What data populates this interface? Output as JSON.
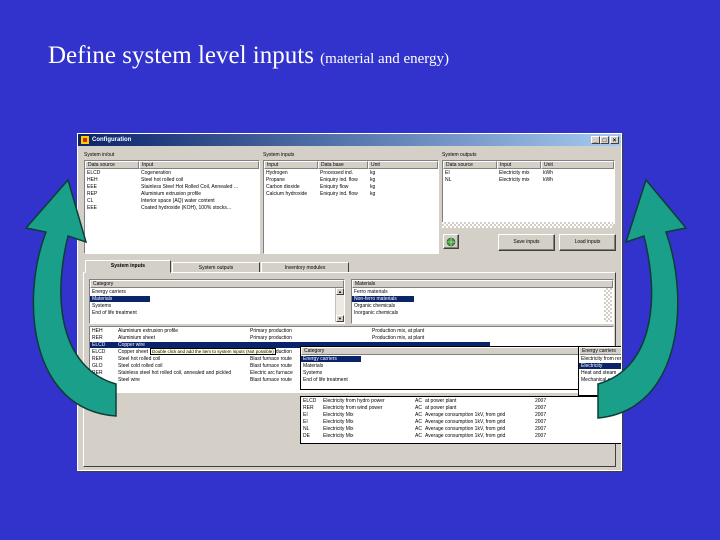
{
  "slide": {
    "title": "Define system level inputs",
    "subtitle": "(material and energy)"
  },
  "window": {
    "title": "Configuration",
    "buttons": {
      "minimize": "_",
      "maximize": "□",
      "close": "×"
    }
  },
  "system_in_out_panel": {
    "label": "System in/out",
    "columns": [
      "Data source",
      "Input"
    ],
    "rows": [
      [
        "ELCD",
        "Cogeneration"
      ],
      [
        "HEH",
        "Steel hot rolled coil"
      ],
      [
        "EEE",
        "Stainless Steel Hot Rolled Coil, Annealed ..."
      ],
      [
        "REP",
        "Aluminium extrusion profile"
      ],
      [
        "CL",
        "Interior space (AQ) water content"
      ],
      [
        "EEE",
        "Coated hydroxide (KOH), 100% stocks..."
      ]
    ]
  },
  "system_inputs_panel": {
    "label": "System inputs",
    "columns": [
      "Input",
      "Data base",
      "Unit"
    ],
    "rows": [
      [
        "Hydrogen",
        "Processed ind.",
        "kg"
      ],
      [
        "Propane",
        "Eniquiry ind. flow",
        "kg"
      ],
      [
        "Carbon dioxide",
        "Eniquiry flow",
        "kg"
      ],
      [
        "Calcium hydroxide",
        "Eniquiry ind. flow",
        "kg"
      ]
    ]
  },
  "system_outputs_panel": {
    "label": "System outputs",
    "columns": [
      "Data source",
      "Input",
      "Unit"
    ],
    "rows": [
      [
        "EI",
        "Electricity mix",
        "kWh"
      ],
      [
        "NL",
        "Electricity mix",
        "kWh"
      ]
    ]
  },
  "buttons": {
    "save_inputs": "Save inputs",
    "load_inputs": "Load inputs"
  },
  "tabs": [
    "System inputs",
    "System outputs",
    "Inventory modules"
  ],
  "category_panel": {
    "header": "Category",
    "items": [
      "Energy carriers",
      "Materials",
      "Systems",
      "End of life treatment"
    ],
    "selected": 1
  },
  "materials_panel": {
    "header": "Materials",
    "items": [
      "Ferro materials",
      "Non-ferro materials",
      "Organic chemicals",
      "Inorganic chemicals"
    ],
    "selected": 1
  },
  "process_list": {
    "rows": [
      [
        "HEH",
        "Aluminium extrusion profile",
        "Primary production",
        "Production mix, at plant"
      ],
      [
        "RER",
        "Aluminium sheet",
        "Primary production",
        "Production mix, at plant"
      ],
      [
        "ELCD",
        "Copper wire",
        "",
        ""
      ],
      [
        "ELCD",
        "Copper sheet",
        "Primary production",
        ""
      ],
      [
        "RER",
        "Steel hot rolled coil",
        "Blast furnace route",
        ""
      ],
      [
        "GLO",
        "Steel cold rolled coil",
        "Blast furnace route",
        ""
      ],
      [
        "RER",
        "Stainless steel hot rolled coil, annealed and pickled",
        "Electric arc furnace",
        ""
      ],
      [
        "GLO",
        "Steel wire",
        "Blast furnace route",
        ""
      ]
    ],
    "selected": 2
  },
  "tooltip": {
    "text": "Double click and add the item to system inputs (Not possible)"
  },
  "energy_category_panel": {
    "header": "Category",
    "items": [
      "Energy carriers",
      "Materials",
      "Systems",
      "End of life treatment"
    ],
    "selected": 0
  },
  "energy_carriers_panel": {
    "header": "Energy carriers",
    "items": [
      "Electricity from renewables",
      "Electricity",
      "Heat and steam",
      "Mechanical energy"
    ],
    "selected": 1
  },
  "electricity_list": {
    "rows": [
      [
        "ELCD",
        "Electricity from hydro power",
        "AC",
        "at power plant",
        "2007"
      ],
      [
        "RER",
        "Electricity from wind power",
        "AC",
        "at power plant",
        "2007"
      ],
      [
        "EI",
        "Electricity Mix",
        "AC",
        "Average consumption 1kV, from grid",
        "2007"
      ],
      [
        "EI",
        "Electricity Mix",
        "AC",
        "Average consumption 1kV, from grid",
        "2007"
      ],
      [
        "NL",
        "Electricity Mix",
        "AC",
        "Average consumption 1kV, from grid",
        "2007"
      ],
      [
        "DE",
        "Electricity Mix",
        "AC",
        "Average consumption 1kV, from grid",
        "2007"
      ]
    ]
  },
  "colors": {
    "background": "#3232cc",
    "arrow_fill": "#1aa08a",
    "selection": "#0a246a",
    "window_face": "#d4d0c8"
  }
}
